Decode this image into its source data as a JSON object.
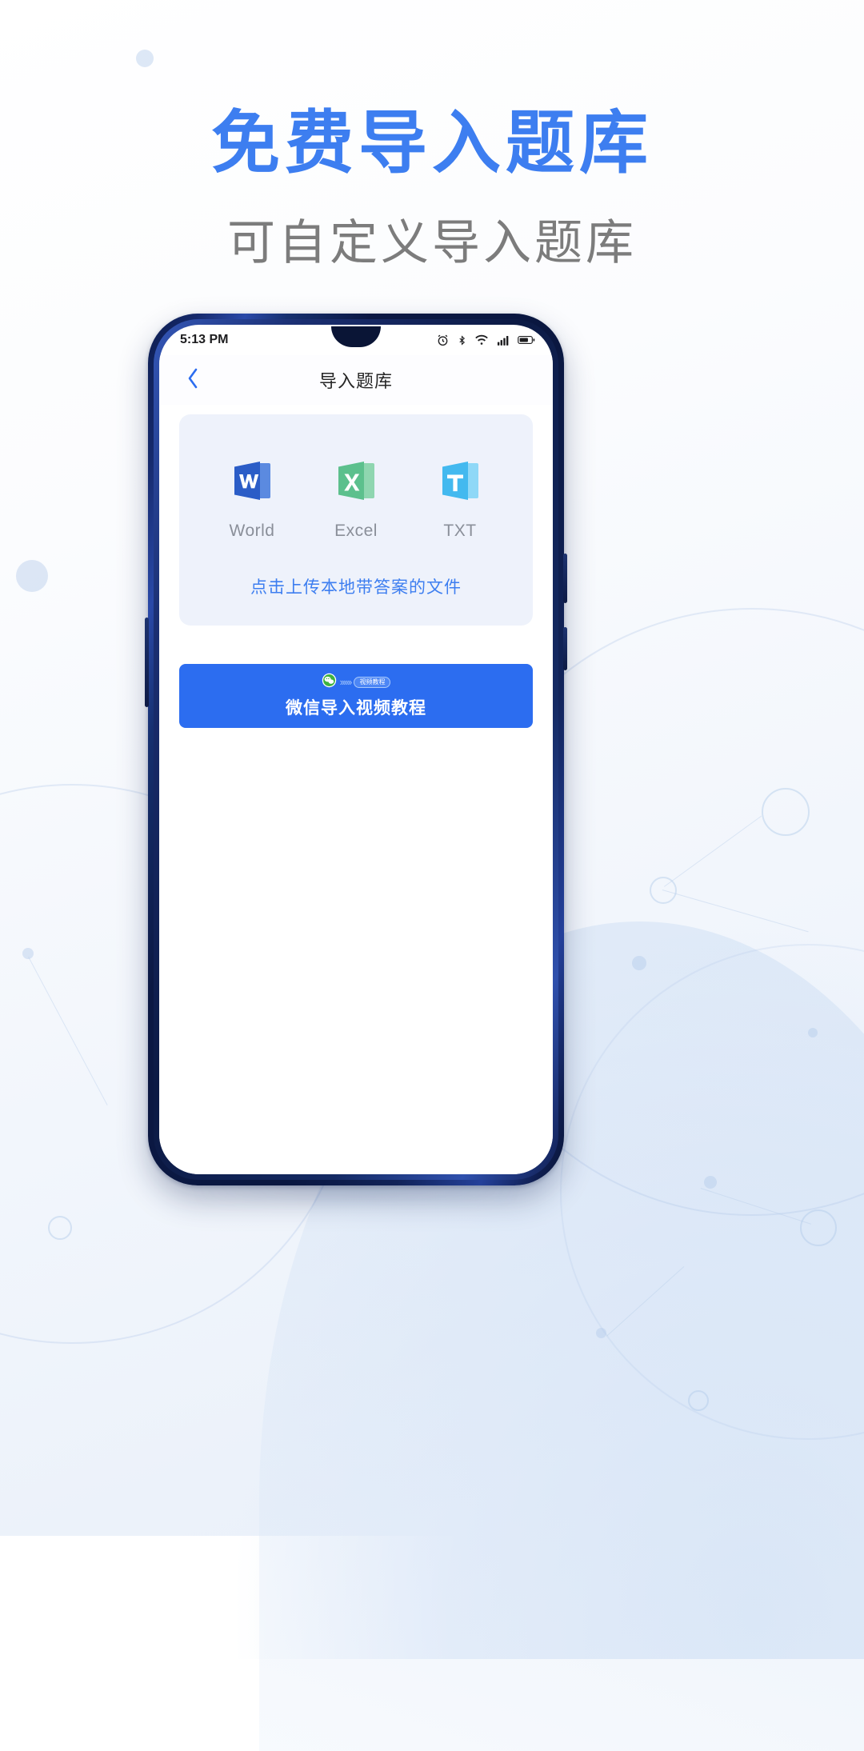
{
  "poster": {
    "headline": "免费导入题库",
    "subhead": "可自定义导入题库",
    "headline_color": "#3d7ef0",
    "subhead_color": "#7c7c7c"
  },
  "phone": {
    "statusbar": {
      "time": "5:13 PM",
      "icons": [
        "alarm-icon",
        "bluetooth-icon",
        "wifi-icon",
        "cellular-signal-icon",
        "battery-icon"
      ]
    },
    "navbar": {
      "back_icon": "chevron-left-icon",
      "title": "导入题库"
    },
    "import_card": {
      "background": "#eef2fb",
      "file_types": [
        {
          "label": "World",
          "icon": "word-file-icon",
          "color": "#2b5dc7"
        },
        {
          "label": "Excel",
          "icon": "excel-file-icon",
          "color": "#5cc08d"
        },
        {
          "label": "TXT",
          "icon": "txt-file-icon",
          "color": "#43b9ef"
        }
      ],
      "upload_link": "点击上传本地带答案的文件",
      "upload_link_color": "#3d7ef0"
    },
    "wechat_button": {
      "label": "微信导入视频教程",
      "background": "#2c6df0",
      "text_color": "#ffffff",
      "badge_icon_left": "wechat-icon",
      "badge_icon_right": "video-icon",
      "badge_text": "视频教程",
      "arrows": "››››››"
    }
  }
}
